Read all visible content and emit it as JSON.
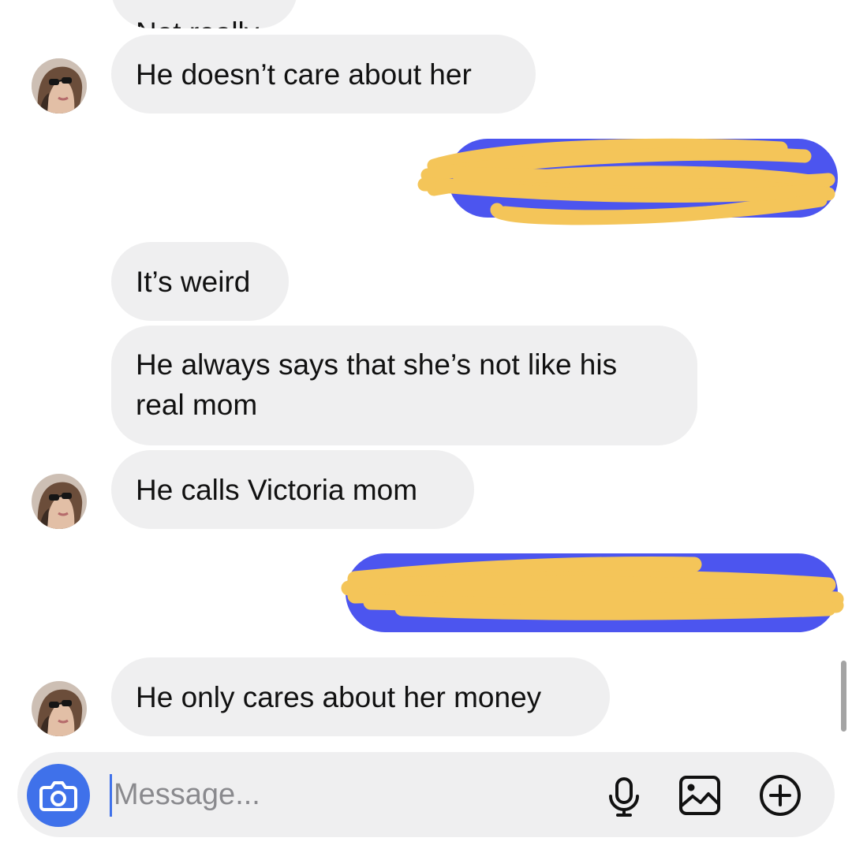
{
  "thread": {
    "messages": [
      {
        "direction": "incoming",
        "text": "Not really",
        "partial": true
      },
      {
        "direction": "incoming",
        "text": "He doesn’t care about her",
        "avatar": "avatar-photo"
      },
      {
        "direction": "outgoing",
        "redacted": true
      },
      {
        "direction": "incoming",
        "text": "It’s weird"
      },
      {
        "direction": "incoming",
        "text": "He always says that she’s not like his real mom"
      },
      {
        "direction": "incoming",
        "text": "He calls Victoria mom",
        "avatar": "avatar-photo"
      },
      {
        "direction": "outgoing",
        "redacted": true
      },
      {
        "direction": "incoming",
        "text": "He only cares about her money",
        "avatar": "avatar-photo"
      }
    ]
  },
  "composer": {
    "placeholder": "Message...",
    "icons": {
      "camera": "camera-icon",
      "mic": "microphone-icon",
      "gallery": "gallery-icon",
      "more": "plus-circle-icon"
    }
  },
  "colors": {
    "incoming_bubble": "#efeff0",
    "outgoing_bubble": "#4c55ef",
    "redaction_scribble": "#f4c559",
    "accent": "#3f71ea"
  }
}
